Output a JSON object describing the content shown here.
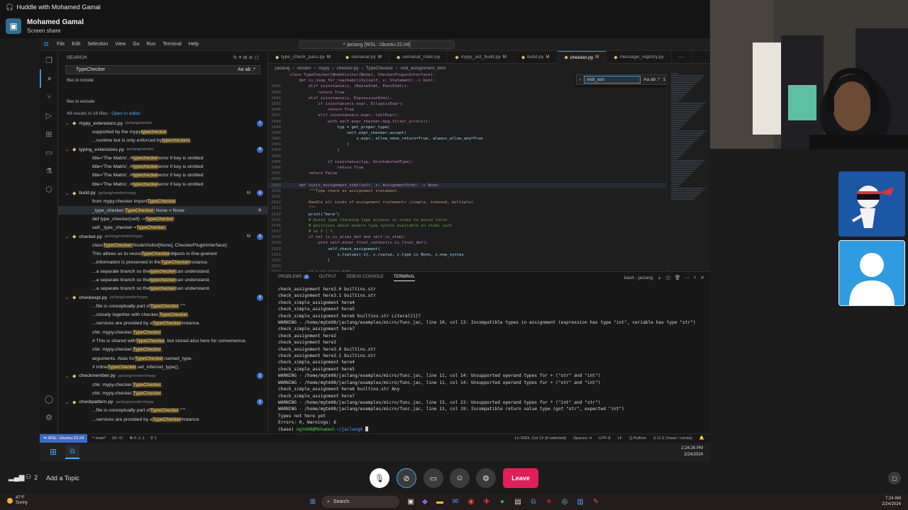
{
  "huddle": {
    "title": "Huddle with Mohamed Gamal",
    "presenter_name": "Mohamed Gamal",
    "presenter_status": "Screen share",
    "participant_count": "2",
    "topic_placeholder": "Add a Topic",
    "leave_label": "Leave"
  },
  "vscode": {
    "menu": [
      "File",
      "Edit",
      "Selection",
      "View",
      "Go",
      "Run",
      "Terminal",
      "Help"
    ],
    "command_center": "jaclang [WSL: Ubuntu-22.04]",
    "search": {
      "header": "SEARCH",
      "query": "TypeChecker",
      "include_label": "files to include",
      "exclude_label": "files to exclude",
      "results_summary": "49 results in 16 files - ",
      "open_in_editor": "Open in editor"
    },
    "results": [
      {
        "kind": "file",
        "name": "mypy_extensions.py",
        "path": "jaclang/vendor",
        "count": "2"
      },
      {
        "kind": "line",
        "pre": "supported by the mypy ",
        "hl": "typechecker",
        "post": "."
      },
      {
        "kind": "line",
        "pre": "...runtime but is only enforced by ",
        "hl": "typecheckers",
        "post": "."
      },
      {
        "kind": "file",
        "name": "typing_extensions.py",
        "path": "jaclang/vendor",
        "count": "4"
      },
      {
        "kind": "line",
        "pre": "title='The Matrix',  # ",
        "hl": "typechecker",
        "post": " error if key is omitted"
      },
      {
        "kind": "line",
        "pre": "title='The Matrix',  # ",
        "hl": "typechecker",
        "post": " error if key is omitted"
      },
      {
        "kind": "line",
        "pre": "title='The Matrix',  # ",
        "hl": "typechecker",
        "post": " error if key is omitted"
      },
      {
        "kind": "line",
        "pre": "title='The Matrix',  # ",
        "hl": "typechecker",
        "post": " error if key is omitted"
      },
      {
        "kind": "file",
        "name": "build.py",
        "path": "jaclang/vendor/mypy",
        "count": "4",
        "mark": "M"
      },
      {
        "kind": "line",
        "pre": "from mypy.checker import ",
        "hl": "TypeChecker",
        "post": ""
      },
      {
        "kind": "line",
        "pre": "_type_checker: ",
        "hl": "TypeChecker",
        "post": " | None = None",
        "selected": true
      },
      {
        "kind": "line",
        "pre": "def type_checker(self) -> ",
        "hl": "TypeChecker",
        "post": ":"
      },
      {
        "kind": "line",
        "pre": "self._type_checker = ",
        "hl": "TypeChecker",
        "post": "("
      },
      {
        "kind": "file",
        "name": "checker.py",
        "path": "jaclang/vendor/mypy",
        "count": "6",
        "mark": "M"
      },
      {
        "kind": "line",
        "pre": "class ",
        "hl": "TypeChecker",
        "post": "(NodeVisitor[None], CheckerPluginInterface):"
      },
      {
        "kind": "line",
        "pre": "This allows us to reuse ",
        "hl": "TypeChecker",
        "post": " objects in fine-grained"
      },
      {
        "kind": "line",
        "pre": "...information is preserved in the ",
        "hl": "TypeChecker",
        "post": " instance."
      },
      {
        "kind": "line",
        "pre": "...a separate branch so the ",
        "hl": "typechecker",
        "post": " can understand."
      },
      {
        "kind": "line",
        "pre": "...a separate branch so the ",
        "hl": "typechecker",
        "post": " can understand."
      },
      {
        "kind": "line",
        "pre": "...a separate branch so the ",
        "hl": "typechecker",
        "post": " can understand."
      },
      {
        "kind": "file",
        "name": "checkexpr.py",
        "path": "jaclang/vendor/mypy",
        "count": "8"
      },
      {
        "kind": "line",
        "pre": "...file is conceptually part of ",
        "hl": "TypeChecker",
        "post": ".\"\"\""
      },
      {
        "kind": "line",
        "pre": "...closely together with checker.",
        "hl": "TypeChecker",
        "post": "."
      },
      {
        "kind": "line",
        "pre": "...services are provided by a ",
        "hl": "TypeChecker",
        "post": " instance."
      },
      {
        "kind": "line",
        "pre": "chk: mypy.checker.",
        "hl": "TypeChecker",
        "post": ""
      },
      {
        "kind": "line",
        "pre": "# This is shared with ",
        "hl": "TypeChecker",
        "post": ", but stored also here for convenience."
      },
      {
        "kind": "line",
        "pre": "chk: mypy.checker.",
        "hl": "TypeChecker",
        "post": ","
      },
      {
        "kind": "line",
        "pre": "arguments. Alias for ",
        "hl": "TypeChecker",
        "post": ".named_type."
      },
      {
        "kind": "line",
        "pre": "# Inline ",
        "hl": "TypeChecker",
        "post": ".set_inferred_type(),"
      },
      {
        "kind": "file",
        "name": "checkmember.py",
        "path": "jaclang/vendor/mypy",
        "count": "2"
      },
      {
        "kind": "line",
        "pre": "chk: mypy.checker.",
        "hl": "TypeChecker",
        "post": ","
      },
      {
        "kind": "line",
        "pre": "chk: mypy.checker.",
        "hl": "TypeChecker",
        "post": ","
      },
      {
        "kind": "file",
        "name": "checkpattern.py",
        "path": "jaclang/vendor/mypy",
        "count": "3"
      },
      {
        "kind": "line",
        "pre": "...file is conceptually part of ",
        "hl": "TypeChecker",
        "post": ".\"\"\""
      },
      {
        "kind": "line",
        "pre": "...services are provided by a ",
        "hl": "TypeChecker",
        "post": " instance."
      }
    ],
    "tabs": [
      {
        "label": "type_check_pass.py",
        "mark": "M"
      },
      {
        "label": "semanal.py",
        "mark": "M"
      },
      {
        "label": "semanal_main.py",
        "mark": ""
      },
      {
        "label": "mypy_ast_build.py",
        "mark": "M"
      },
      {
        "label": "build.py",
        "mark": "M"
      },
      {
        "label": "checker.py",
        "mark": "M",
        "active": true
      },
      {
        "label": "message_registry.py",
        "mark": ""
      }
    ],
    "breadcrumbs": [
      "jaclang",
      "vendor",
      "mypy",
      "checker.py",
      "TypeChecker",
      "visit_assignment_stmt"
    ],
    "find": {
      "query": "visit_ass",
      "count": "1 of 4",
      "options": "Aa ab .*"
    },
    "code": [
      {
        "n": "",
        "t": "class TypeChecker(NodeVisitor[None], CheckerPluginInterface):"
      },
      {
        "n": "",
        "t": "    def is_noop_for_reachability(self, s: Statement) -> bool:"
      },
      {
        "n": "2892",
        "t": "        elif isinstance(s, (RaiseStmt, PassStmt)):"
      },
      {
        "n": "2893",
        "t": "            return True"
      },
      {
        "n": "2894",
        "t": "        elif isinstance(s, ExpressionStmt):"
      },
      {
        "n": "2895",
        "t": "            if isinstance(s.expr, EllipsisExpr):"
      },
      {
        "n": "2896",
        "t": "                return True"
      },
      {
        "n": "2897",
        "t": "            elif isinstance(s.expr, CallExpr):"
      },
      {
        "n": "2898",
        "t": "                with self.expr_checker.msg.filter_errors():"
      },
      {
        "n": "2899",
        "t": "                    typ = get_proper_type("
      },
      {
        "n": "2900",
        "t": "                        self.expr_checker.accept("
      },
      {
        "n": "2901",
        "t": "                            s.expr, allow_none_return=True, always_allow_any=True"
      },
      {
        "n": "2902",
        "t": "                        )"
      },
      {
        "n": "2903",
        "t": "                    )"
      },
      {
        "n": "2904",
        "t": ""
      },
      {
        "n": "2905",
        "t": "                if isinstance(typ, UninhabitedType):"
      },
      {
        "n": "2906",
        "t": "                    return True"
      },
      {
        "n": "2907",
        "t": "        return False"
      },
      {
        "n": "2908",
        "t": ""
      },
      {
        "n": "2909",
        "t": "    def visit_assignment_stmt(self, s: AssignmentStmt) -> None:"
      },
      {
        "n": "2910",
        "t": "        \"\"\"Type check an assignment statement."
      },
      {
        "n": "2911",
        "t": ""
      },
      {
        "n": "2912",
        "t": "        Handle all kinds of assignment statements (simple, indexed, multiple)."
      },
      {
        "n": "2913",
        "t": "        \"\"\""
      },
      {
        "n": "2914",
        "t": "        print(\"here\")"
      },
      {
        "n": "2915",
        "t": "        # Avoid type checking type aliases in stubs to avoid false"
      },
      {
        "n": "2916",
        "t": "        # positives about modern type syntax available in stubs such"
      },
      {
        "n": "2917",
        "t": "        # as X | Y."
      },
      {
        "n": "2918",
        "t": "        if not (s.is_alias_def and self.is_stub):"
      },
      {
        "n": "2919",
        "t": "            with self.enter_final_context(s.is_final_def):"
      },
      {
        "n": "2920",
        "t": "                self.check_assignment("
      },
      {
        "n": "2921",
        "t": "                    s.lvalues[-1], s.rvalue, s.type is None, s.new_syntax"
      },
      {
        "n": "2922",
        "t": "                )"
      },
      {
        "n": "2923",
        "t": ""
      },
      {
        "n": "2924",
        "t": "        if s.is_alias_def:"
      }
    ],
    "panel_tabs": [
      {
        "label": "PROBLEMS",
        "badge": "1"
      },
      {
        "label": "OUTPUT"
      },
      {
        "label": "DEBUG CONSOLE"
      },
      {
        "label": "TERMINAL",
        "active": true
      }
    ],
    "terminal_name": "bash - jaclang",
    "terminal_lines": [
      "check_assignment here3.0 builtins.str",
      "check_assignment here3.1 builtins.str",
      "check_simple_assignment here4",
      "check_simple_assignment here5",
      "check_simple_assignment here6 builtins.str Literal[1]?",
      "WARNING - /home/mgtm98/jaclang/examples/micro/func.jac, line 10, col 13: Incompatible types in assignment (expression has type \"int\", variable has type \"str\")",
      "check_simple_assignment here7",
      "check_assignment here2",
      "check_assignment here3",
      "check_assignment here3.0 builtins.str",
      "check_assignment here3.1 builtins.str",
      "check_simple_assignment here4",
      "check_simple_assignment here5",
      "WARNING - /home/mgtm98/jaclang/examples/micro/func.jac, line 11, col 14: Unsupported operand types for + (\"str\" and \"int\")",
      "WARNING - /home/mgtm98/jaclang/examples/micro/func.jac, line 11, col 14: Unsupported operand types for + (\"str\" and \"int\")",
      "check_simple_assignment here6 builtins.str Any",
      "check_simple_assignment here7",
      "WARNING - /home/mgtm98/jaclang/examples/micro/func.jac, line 13, col 23: Unsupported operand types for * (\"int\" and \"str\")",
      "WARNING - /home/mgtm98/jaclang/examples/micro/func.jac, line 13, col 19: Incompatible return value type (got \"str\", expected \"int\")",
      "Types not here yet",
      "Errors: 0, Warnings: 8"
    ],
    "prompt": {
      "env": "(base) ",
      "user": "mgtm98@Mohamed",
      "path": ":~/jaclang$ "
    },
    "status": {
      "remote": "WSL: Ubuntu-22.04",
      "branch": "main*",
      "sync": "19↓ 0↑",
      "problems": "⊗ 0 ⚠ 1",
      "ports": "1",
      "cursor": "Ln 3003, Col 13 (8 selected)",
      "spaces": "Spaces: 4",
      "encoding": "UTF-8",
      "eol": "LF",
      "language": "Python",
      "interpreter": "3.11.5 ('base': conda)"
    },
    "inner_clock": {
      "time": "2:24:26 PM",
      "date": "2/24/2024"
    }
  },
  "windows": {
    "weather_temp": "47°F",
    "weather_cond": "Sunny",
    "search_label": "Search",
    "time": "7:24 AM",
    "date": "2/24/2024"
  },
  "colors": {
    "leave": "#e01e5a",
    "vscode_accent": "#3a96dd",
    "highlight": "#5c4a1f"
  }
}
